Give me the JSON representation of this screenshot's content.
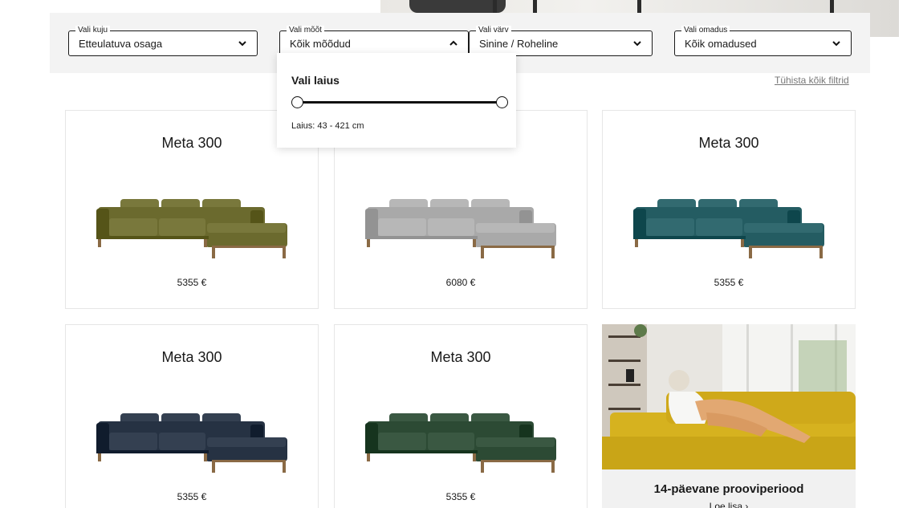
{
  "filters": [
    {
      "legend": "Vali kuju",
      "value": "Etteulatuva osaga",
      "open": false
    },
    {
      "legend": "Vali mõõt",
      "value": "Kõik mõõdud",
      "open": true
    },
    {
      "legend": "Vali värv",
      "value": "Sinine / Roheline",
      "open": false
    },
    {
      "legend": "Vali omadus",
      "value": "Kõik omadused",
      "open": false
    }
  ],
  "dropdown": {
    "title": "Vali laius",
    "range_text": "Laius: 43 - 421 cm",
    "range_min": 43,
    "range_max": 421,
    "selected_min": 43,
    "selected_max": 421
  },
  "clear_filters": "Tühista kõik filtrid",
  "products": [
    {
      "name": "Meta 300",
      "price": "5355 €",
      "color": "#6b6a2e"
    },
    {
      "name": "Meta 300",
      "price": "6080 €",
      "color": "#a9a9a9"
    },
    {
      "name": "Meta 300",
      "price": "5355 €",
      "color": "#245c62"
    },
    {
      "name": "Meta 300",
      "price": "5355 €",
      "color": "#263243"
    },
    {
      "name": "Meta 300",
      "price": "5355 €",
      "color": "#2c4a34"
    }
  ],
  "promo": {
    "title": "14-päevane prooviperiood",
    "link": "Loe lisa ›"
  },
  "colors": {
    "filter_bar_bg": "#f3f3f3",
    "accent": "#1a1a1a",
    "sofa_leg": "#8a6a45",
    "promo_sofa": "#d6b21f"
  }
}
